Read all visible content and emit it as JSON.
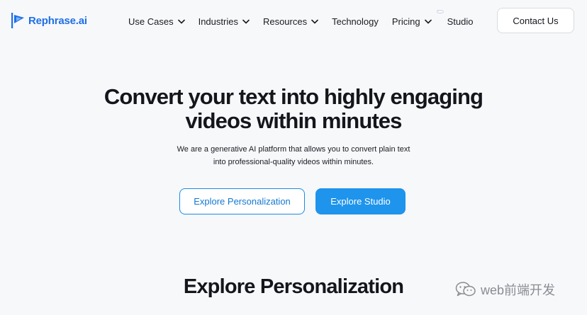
{
  "nav": {
    "logo_text": "Rephrase.ai",
    "items": [
      {
        "label": "Use Cases",
        "has_dropdown": true
      },
      {
        "label": "Industries",
        "has_dropdown": true
      },
      {
        "label": "Resources",
        "has_dropdown": true
      },
      {
        "label": "Technology",
        "has_dropdown": false
      },
      {
        "label": "Pricing",
        "has_dropdown": true
      }
    ],
    "studio_label": "Studio",
    "contact_label": "Contact Us"
  },
  "hero": {
    "title_line1_regular": "Convert your text into ",
    "title_line1_bold": "highly engaging",
    "title_line2_bold": "videos",
    "title_line2_regular": " within minutes",
    "subtitle_line1": "We are a generative AI platform that allows you to convert plain text",
    "subtitle_line2": "into professional-quality videos within minutes.",
    "primary_cta": "Explore Personalization",
    "secondary_cta": "Explore Studio"
  },
  "section": {
    "title_regular": "Explore ",
    "title_bold": "Personalization"
  },
  "watermark": {
    "text": "web前端开发",
    "icon": "wechat-icon"
  },
  "colors": {
    "brand_blue": "#1f6fe6",
    "button_blue": "#1e94ec",
    "outline_blue": "#1a8be6",
    "background": "#f7f8fa"
  }
}
